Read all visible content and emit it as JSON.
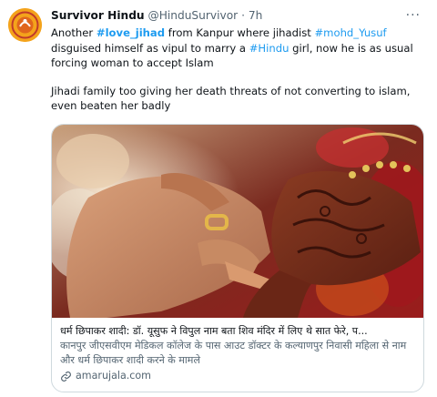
{
  "tweet": {
    "author_name": "Survivor Hindu",
    "author_handle": "@HinduSurvivor",
    "separator": "·",
    "time": "7h",
    "more_label": "···",
    "para1_a": "Another ",
    "hashtag_love_jihad": "#love_jihad",
    "para1_b": " from Kanpur where jihadist ",
    "hashtag_mohd_yusuf": "#mohd_Yusuf",
    "para1_c": " disguised himself as vipul to marry a ",
    "hashtag_hindu": "#Hindu",
    "para1_d": " girl, now he is as usual forcing woman to accept Islam",
    "para2": "Jihadi family too giving her death threats of not converting to islam, even beaten her badly"
  },
  "card": {
    "title": "धर्म छिपाकर शादी: डॉ. यूसुफ ने विपुल नाम बता शिव मंदिर में लिए थे सात फेरे, प...",
    "description": "कानपुर जीएसवीएम मेडिकल कॉलेज के पास आउट डॉक्टर के कल्याणपुर निवासी महिला से नाम और धर्म छिपाकर शादी करने के मामले",
    "domain": "amarujala.com"
  },
  "colors": {
    "link_blue": "#1d9bf0",
    "secondary_text": "#536471",
    "avatar_bg": "#f4a31b"
  },
  "icons": {
    "more": "more-dots-icon",
    "link": "link-icon",
    "avatar": "survivor-hindu-logo"
  }
}
